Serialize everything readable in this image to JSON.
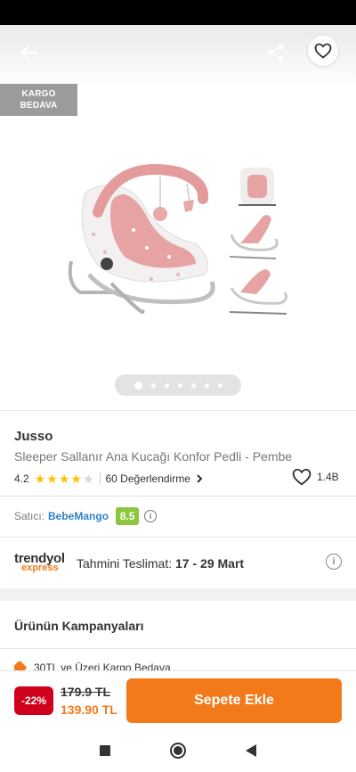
{
  "badge": {
    "line1": "KARGO",
    "line2": "BEDAVA"
  },
  "icons": {
    "back": "arrow-left-icon",
    "share": "share-icon",
    "favorite": "heart-icon"
  },
  "gallery": {
    "dot_count": 7,
    "active_index": 0
  },
  "product": {
    "brand": "Jusso",
    "name": "Sleeper Sallanır Ana Kucağı Konfor Pedli - Pembe",
    "rating": "4.2",
    "rating_value": 4.2,
    "review_text": "60 Değerlendirme",
    "favorite_count": "1.4B"
  },
  "seller": {
    "label": "Satıcı:",
    "name": "BebeMango",
    "score": "8.5"
  },
  "express": {
    "logo_top": "trendyol",
    "logo_bottom": "express",
    "delivery_label": "Tahmini Teslimat: ",
    "delivery_range": "17 - 29 Mart"
  },
  "campaigns": {
    "title": "Ürünün Kampanyaları",
    "first_item": "30TL ve Üzeri Kargo Bedava"
  },
  "purchase": {
    "discount": "-22%",
    "old_price": "179.9 TL",
    "new_price": "139.90 TL",
    "button": "Sepete Ekle"
  },
  "colors": {
    "accent": "#f27a1a",
    "discount_red": "#d0021b",
    "seller_blue": "#2c82c9",
    "score_green": "#8cc63f",
    "star": "#ffc000"
  }
}
